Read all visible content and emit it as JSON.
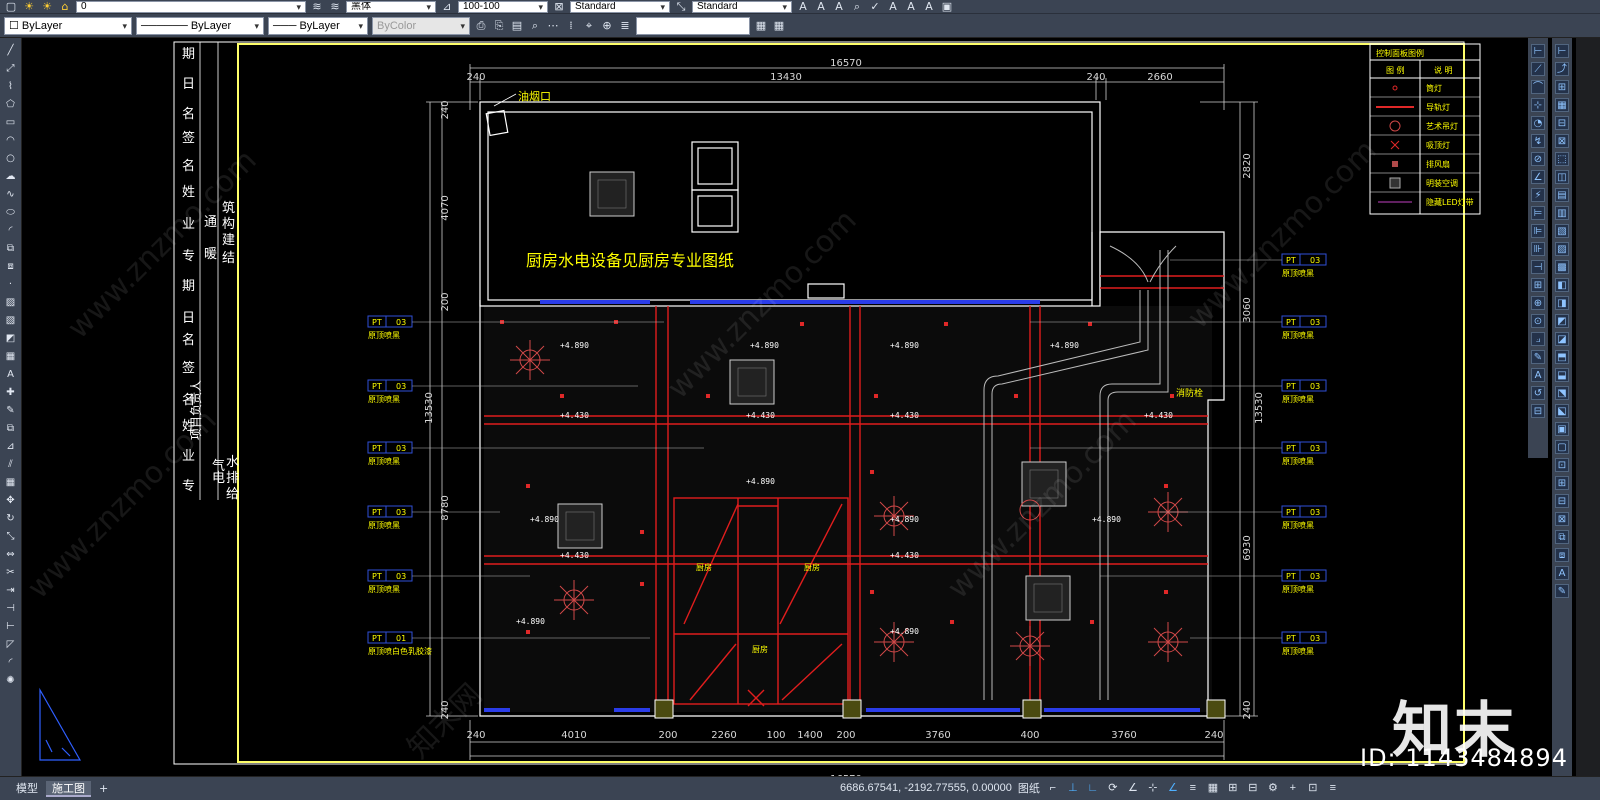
{
  "toolbar1": {
    "layer_value": "0",
    "font_value": "黑体",
    "dim_value": "100-100",
    "text_style": "Standard",
    "dim_style": "Standard"
  },
  "toolbar2": {
    "layer_combo": "ByLayer",
    "linetype_combo": "ByLayer",
    "lineweight_combo": "ByLayer",
    "color_combo": "ByColor",
    "search_value": ""
  },
  "title_block": {
    "top_labels": [
      "期",
      "日",
      "名",
      "签",
      "名",
      "姓",
      "业",
      "专"
    ],
    "discipline": [
      "通",
      "筑",
      "构"
    ],
    "discipline2": [
      "暖",
      "建",
      "结"
    ],
    "mid_labels": [
      "期",
      "日",
      "名",
      "签",
      "名",
      "姓",
      "业",
      "专"
    ],
    "bottom": [
      "项目负责人",
      "电",
      "气",
      "给",
      "排",
      "水"
    ]
  },
  "plan": {
    "dim_total": "16570",
    "dim_top": [
      "240",
      "13430",
      "240",
      "2660"
    ],
    "dim_bottom": [
      "240",
      "4010",
      "200",
      "2260",
      "100",
      "1400",
      "200",
      "3760",
      "400",
      "3760",
      "240"
    ],
    "dim_left": [
      "240",
      "4070",
      "200",
      "13530",
      "8780",
      "240"
    ],
    "dim_right": [
      "2820",
      "3060",
      "13530",
      "6930",
      "240"
    ],
    "note_kitchen": "厨房水电设备见厨房专业图纸",
    "label_smoke": "油烟口",
    "label_fire_hydrant": "消防栓",
    "label_room1": "厨房",
    "label_room2": "厨房",
    "label_room3": "厨房",
    "heights": [
      "+4.890",
      "+4.890",
      "+4.890",
      "+4.890",
      "+4.430",
      "+4.430",
      "+4.430",
      "+4.430",
      "+4.890",
      "+4.890",
      "+4.890",
      "+4.430",
      "+4.430",
      "+4.890",
      "+4.890",
      "+4.890"
    ],
    "tags_left": [
      {
        "code": "PT",
        "num": "03",
        "desc": "原顶喷黑"
      },
      {
        "code": "PT",
        "num": "03",
        "desc": "原顶喷黑"
      },
      {
        "code": "PT",
        "num": "03",
        "desc": "原顶喷黑"
      },
      {
        "code": "PT",
        "num": "03",
        "desc": "原顶喷黑"
      },
      {
        "code": "PT",
        "num": "03",
        "desc": "原顶喷黑"
      },
      {
        "code": "PT",
        "num": "01",
        "desc": "原顶喷白色乳胶漆"
      }
    ],
    "tags_right": [
      {
        "code": "PT",
        "num": "03",
        "desc": "原顶喷黑"
      },
      {
        "code": "PT",
        "num": "03",
        "desc": "原顶喷黑"
      },
      {
        "code": "PT",
        "num": "03",
        "desc": "原顶喷黑"
      },
      {
        "code": "PT",
        "num": "03",
        "desc": "原顶喷黑"
      },
      {
        "code": "PT",
        "num": "03",
        "desc": "原顶喷黑"
      },
      {
        "code": "PT",
        "num": "03",
        "desc": "原顶喷黑"
      }
    ]
  },
  "legend": {
    "title": "控制面板图例",
    "col1": "图 例",
    "col2": "说 明",
    "items": [
      "筒灯",
      "导轨灯",
      "艺术吊灯",
      "吸顶灯",
      "排风扇",
      "明装空调",
      "隐藏LED灯带"
    ]
  },
  "tabs": {
    "model": "模型",
    "layout": "施工图",
    "add": "+"
  },
  "status": {
    "coords": "6686.67541, -2192.77555, 0.00000",
    "paper": "图纸"
  },
  "brand": {
    "logo": "知末",
    "id": "ID: 1143484894",
    "watermark": "www.znzmo.com",
    "watermark_cn": "知末网"
  },
  "colors": {
    "bg": "#000000",
    "wall": "#ffffff",
    "beam": "#e01d1d",
    "dim": "#d8d8d8",
    "text_yellow": "#ffff00",
    "tag_blue": "#2f4fd8",
    "frame_yellow": "#ffff6a"
  }
}
